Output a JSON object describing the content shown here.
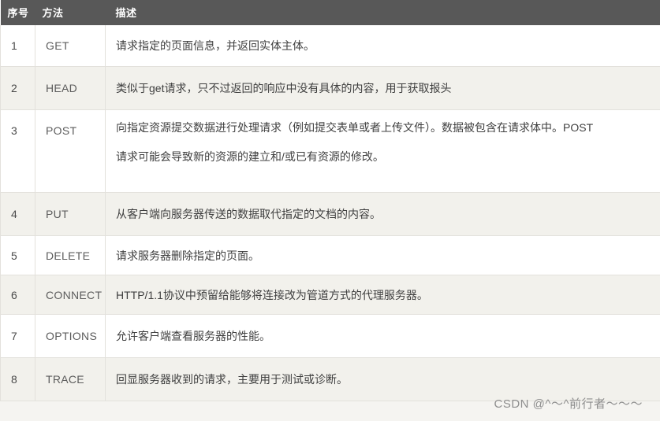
{
  "table": {
    "headers": {
      "num": "序号",
      "method": "方法",
      "description": "描述"
    },
    "colors": {
      "header_bg": "#585858",
      "header_text": "#ffffff",
      "row_odd_bg": "#ffffff",
      "row_even_bg": "#f2f1ec",
      "border": "#e3e1dc",
      "page_bg": "#f5f4f1",
      "body_text": "#3f3f3f",
      "watermark_text": "#8e8e8e"
    },
    "rows": [
      {
        "num": "1",
        "method": "GET",
        "desc_lines": [
          "请求指定的页面信息，并返回实体主体。"
        ]
      },
      {
        "num": "2",
        "method": "HEAD",
        "desc_lines": [
          "类似于get请求，只不过返回的响应中没有具体的内容，用于获取报头"
        ]
      },
      {
        "num": "3",
        "method": "POST",
        "desc_lines": [
          "向指定资源提交数据进行处理请求（例如提交表单或者上传文件）。数据被包含在请求体中。POST",
          "请求可能会导致新的资源的建立和/或已有资源的修改。"
        ]
      },
      {
        "num": "4",
        "method": "PUT",
        "desc_lines": [
          "从客户端向服务器传送的数据取代指定的文档的内容。"
        ]
      },
      {
        "num": "5",
        "method": "DELETE",
        "desc_lines": [
          "请求服务器删除指定的页面。"
        ]
      },
      {
        "num": "6",
        "method": "CONNECT",
        "desc_lines": [
          "HTTP/1.1协议中预留给能够将连接改为管道方式的代理服务器。"
        ]
      },
      {
        "num": "7",
        "method": "OPTIONS",
        "desc_lines": [
          "允许客户端查看服务器的性能。"
        ]
      },
      {
        "num": "8",
        "method": "TRACE",
        "desc_lines": [
          "回显服务器收到的请求，主要用于测试或诊断。"
        ]
      }
    ]
  },
  "watermark": {
    "text": "CSDN @^～^前行者～～～"
  }
}
